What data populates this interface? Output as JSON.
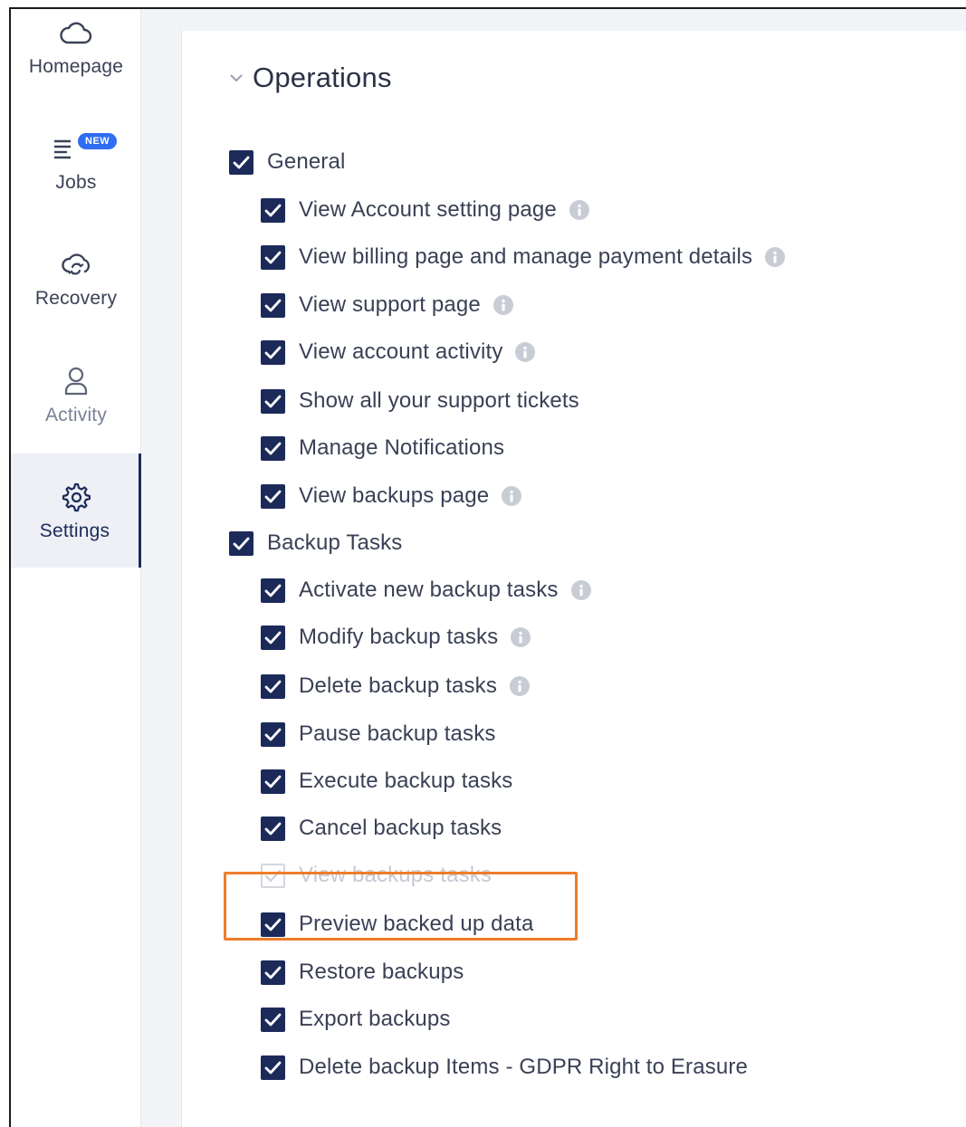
{
  "nav": {
    "homepage": "Homepage",
    "jobs": "Jobs",
    "jobs_badge": "NEW",
    "recovery": "Recovery",
    "activity": "Activity",
    "settings": "Settings"
  },
  "section": {
    "title": "Operations"
  },
  "groups": [
    {
      "label": "General",
      "checked": true,
      "items": [
        {
          "label": "View Account setting page",
          "checked": true,
          "info": true
        },
        {
          "label": "View billing page and manage payment details",
          "checked": true,
          "info": true
        },
        {
          "label": "View support page",
          "checked": true,
          "info": true
        },
        {
          "label": "View account activity",
          "checked": true,
          "info": true
        },
        {
          "label": "Show all your support tickets",
          "checked": true,
          "info": false
        },
        {
          "label": "Manage Notifications",
          "checked": true,
          "info": false
        },
        {
          "label": "View backups page",
          "checked": true,
          "info": true
        }
      ]
    },
    {
      "label": "Backup Tasks",
      "checked": true,
      "items": [
        {
          "label": "Activate new backup tasks",
          "checked": true,
          "info": true
        },
        {
          "label": "Modify backup tasks",
          "checked": true,
          "info": true
        },
        {
          "label": "Delete backup tasks",
          "checked": true,
          "info": true
        },
        {
          "label": "Pause backup tasks",
          "checked": true,
          "info": false
        },
        {
          "label": "Execute backup tasks",
          "checked": true,
          "info": false
        },
        {
          "label": "Cancel backup tasks",
          "checked": true,
          "info": false
        },
        {
          "label": "View backups tasks",
          "checked": true,
          "info": false,
          "disabled": true
        },
        {
          "label": "Preview backed up data",
          "checked": true,
          "info": false,
          "highlighted": true
        },
        {
          "label": "Restore backups",
          "checked": true,
          "info": false
        },
        {
          "label": "Export backups",
          "checked": true,
          "info": false
        },
        {
          "label": "Delete backup Items - GDPR Right to Erasure",
          "checked": true,
          "info": false
        }
      ]
    }
  ],
  "colors": {
    "checkbox": "#1c2a5a",
    "highlight": "#ee7d2b",
    "info_icon": "#c8ccd5",
    "badge": "#2f6ef2"
  },
  "icons": {
    "homepage": "cloud-icon",
    "jobs": "list-icon",
    "recovery": "cloud-sync-icon",
    "activity": "user-icon",
    "settings": "gear-icon",
    "section": "chevron-down-icon",
    "check": "checkmark-icon",
    "info": "info-icon"
  }
}
